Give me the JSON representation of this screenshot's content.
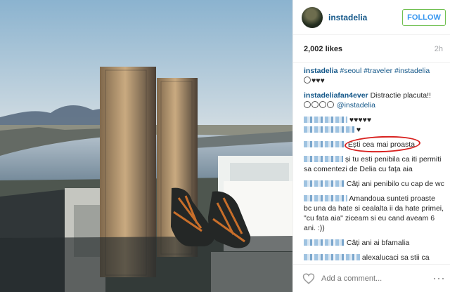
{
  "post": {
    "username": "instadelia",
    "follow_label": "FOLLOW",
    "likes": "2,002 likes",
    "time": "2h",
    "add_comment_placeholder": "Add a comment..."
  },
  "comments": [
    {
      "author": "instadelia",
      "text": "#seoul #traveler #instadelia",
      "hearts": "♥♥♥"
    },
    {
      "author": "instadeliafan4ever",
      "text": "Distractie placuta!!",
      "mention": "@instadelia"
    },
    {
      "text_hearts": "♥♥♥♥♥"
    },
    {
      "text": "♥"
    },
    {
      "text": "Ești cea mai proasta"
    },
    {
      "text": "și tu esti penibila ca iti permiti sa comentezi de Delia cu fața aia"
    },
    {
      "text": "Câți ani penibilo cu cap de wc"
    },
    {
      "text": "Amandoua sunteti proaste bc una da hate si cealalta ii da hate primei, \"cu fata aia\" ziceam si eu cand aveam 6 ani. :))"
    },
    {
      "text": "Câți ani ai bfamalia"
    },
    {
      "text": "alexalucaci sa stii ca"
    }
  ]
}
